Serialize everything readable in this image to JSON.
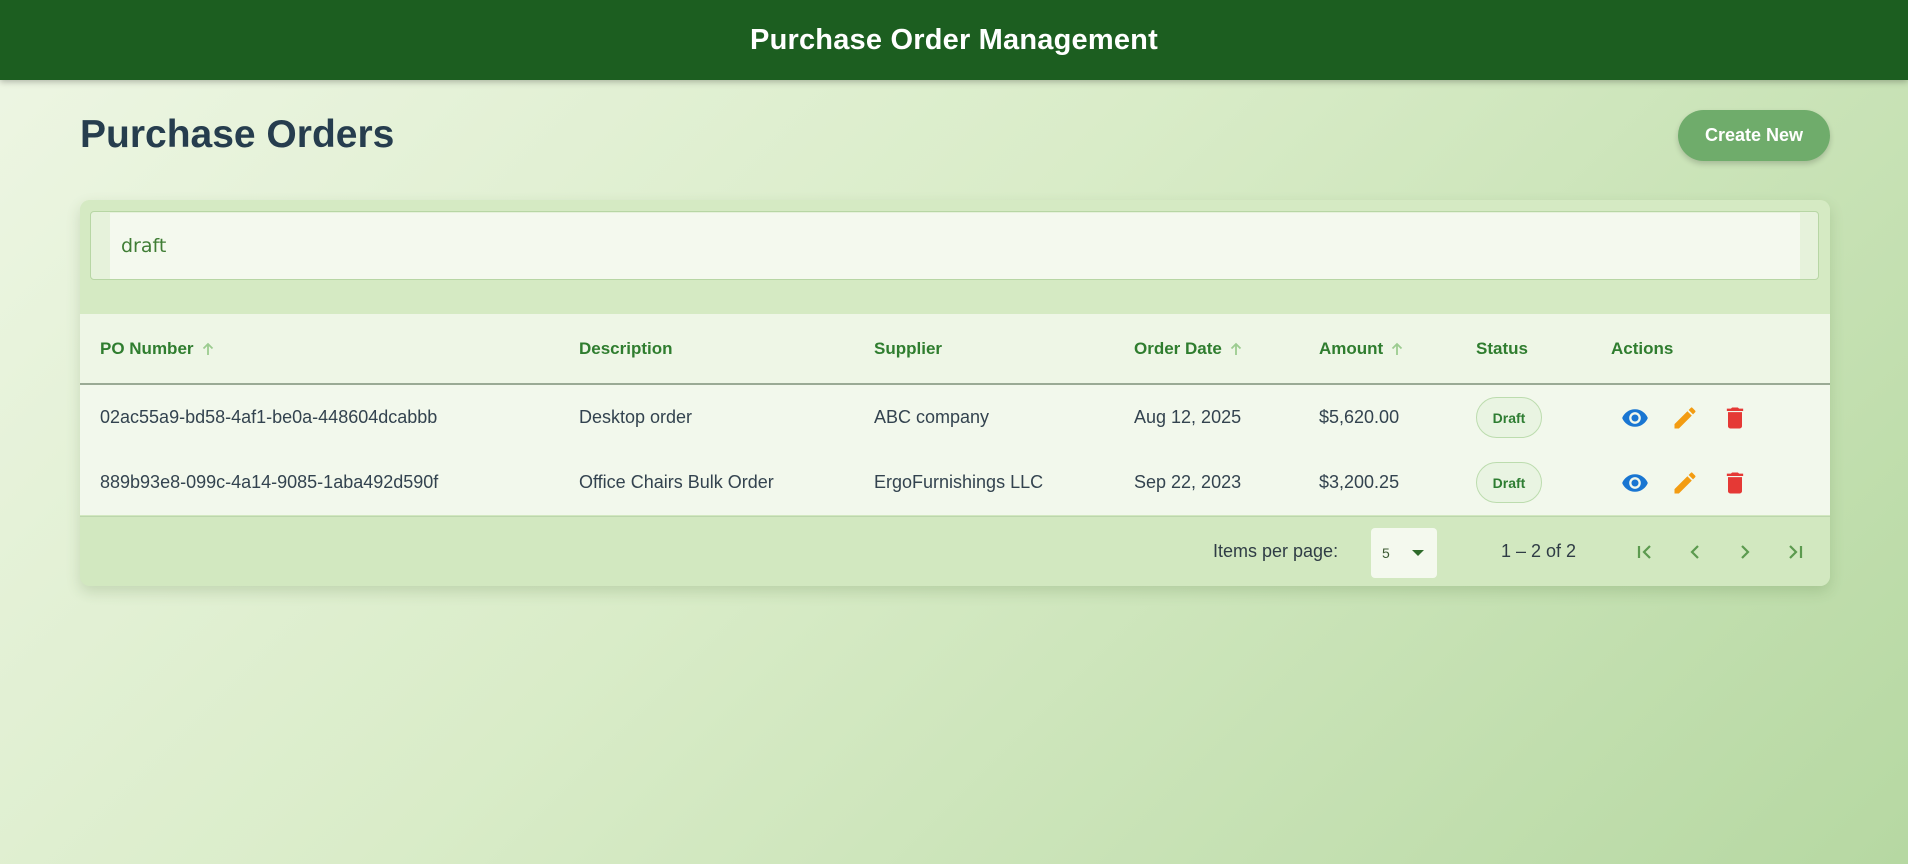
{
  "app": {
    "title": "Purchase Order Management"
  },
  "page": {
    "title": "Purchase Orders",
    "create_label": "Create New"
  },
  "filter": {
    "value": "draft"
  },
  "table": {
    "columns": [
      {
        "label": "PO Number",
        "sortable": true
      },
      {
        "label": "Description",
        "sortable": false
      },
      {
        "label": "Supplier",
        "sortable": false
      },
      {
        "label": "Order Date",
        "sortable": true
      },
      {
        "label": "Amount",
        "sortable": true
      },
      {
        "label": "Status",
        "sortable": false
      },
      {
        "label": "Actions",
        "sortable": false
      }
    ],
    "rows": [
      {
        "po_number": "02ac55a9-bd58-4af1-be0a-448604dcabbb",
        "description": "Desktop order",
        "supplier": "ABC company",
        "order_date": "Aug 12, 2025",
        "amount": "$5,620.00",
        "status": "Draft"
      },
      {
        "po_number": "889b93e8-099c-4a14-9085-1aba492d590f",
        "description": "Office Chairs Bulk Order",
        "supplier": "ErgoFurnishings LLC",
        "order_date": "Sep 22, 2023",
        "amount": "$3,200.25",
        "status": "Draft"
      }
    ],
    "actions": [
      "eye-icon",
      "pencil-icon",
      "trash-icon"
    ]
  },
  "pagination": {
    "items_per_page_label": "Items per page:",
    "items_per_page": "5",
    "range": "1 – 2 of 2"
  },
  "colors": {
    "header": "#1c5e20",
    "accent": "#2e7d32",
    "button": "#6fac6b",
    "view": "#1976d2",
    "edit": "#f39c12",
    "delete": "#e53935"
  }
}
